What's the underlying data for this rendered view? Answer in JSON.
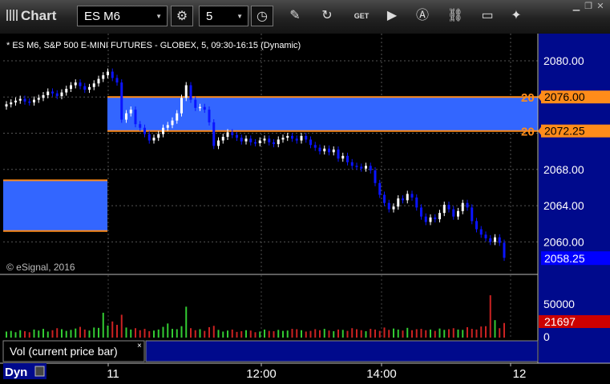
{
  "toolbar": {
    "app_title": "Chart",
    "symbol": "ES M6",
    "interval": "5",
    "icons": [
      "pencil-icon",
      "refresh-icon",
      "get-icon",
      "play-icon",
      "alert-icon",
      "link-icon",
      "comment-icon",
      "twitter-icon"
    ],
    "window_icons": [
      "minimize-icon",
      "restore-icon",
      "close-icon"
    ]
  },
  "chart_header": "* ES M6, S&P 500 E-MINI FUTURES - GLOBEX, 5, 09:30-16:15 (Dynamic)",
  "copyright": "© eSignal, 2016",
  "volume_label": "Vol (current price bar)",
  "dyn_label": "Dyn",
  "colors": {
    "background": "#000000",
    "up": "#ffffff",
    "down": "#0a14ff",
    "zone_fill": "#3366ff",
    "zone_edge": "#ff8c1a",
    "last_price_tag": "#0000ff",
    "volume_tag": "#cc0000",
    "axis_text": "#ffffff"
  },
  "chart_data": [
    {
      "type": "candlestick",
      "title": "",
      "ylim": [
        2056.5,
        2083.0
      ],
      "y_ticks": [
        "2080.00",
        "2076.00",
        "2072.00",
        "2068.00",
        "2064.00",
        "2060.00"
      ],
      "x_ticks": [
        "11",
        "12:00",
        "14:00",
        "12"
      ],
      "zones": [
        {
          "low": 2072.25,
          "high": 2076.0,
          "tag_low": "2072.25",
          "tag_high": "2076.00",
          "left_label": "20"
        },
        {
          "low": 2061.2,
          "high": 2066.8
        }
      ],
      "last_price": "2058.25",
      "close": [
        2075.2,
        2075.4,
        2075.6,
        2075.8,
        2075.5,
        2075.4,
        2075.7,
        2075.9,
        2076.2,
        2076.6,
        2076.4,
        2076.1,
        2076.5,
        2076.9,
        2077.3,
        2077.6,
        2077.2,
        2076.8,
        2077.1,
        2077.5,
        2078.0,
        2078.4,
        2078.8,
        2078.1,
        2077.6,
        2073.5,
        2074.2,
        2074.6,
        2073.0,
        2072.6,
        2071.9,
        2071.2,
        2071.5,
        2071.9,
        2072.6,
        2072.9,
        2073.4,
        2074.2,
        2075.9,
        2077.3,
        2075.7,
        2074.8,
        2074.9,
        2074.6,
        2073.2,
        2070.6,
        2071.2,
        2071.6,
        2072.1,
        2071.8,
        2071.5,
        2071.1,
        2071.4,
        2071.0,
        2070.9,
        2071.2,
        2071.4,
        2071.0,
        2070.8,
        2071.3,
        2071.5,
        2071.7,
        2071.4,
        2071.2,
        2071.7,
        2071.3,
        2070.7,
        2070.4,
        2070.0,
        2070.3,
        2069.9,
        2070.2,
        2069.2,
        2069.5,
        2068.8,
        2068.4,
        2068.3,
        2068.1,
        2068.4,
        2067.9,
        2066.5,
        2065.2,
        2064.3,
        2063.6,
        2063.9,
        2064.8,
        2064.6,
        2065.3,
        2064.9,
        2063.8,
        2062.8,
        2062.2,
        2062.7,
        2062.5,
        2063.2,
        2064.1,
        2063.6,
        2062.8,
        2063.4,
        2064.3,
        2063.8,
        2062.3,
        2061.4,
        2060.8,
        2060.4,
        2060.0,
        2060.5,
        2059.9,
        2058.25
      ],
      "volume": [
        9000,
        10000,
        8000,
        11000,
        9500,
        8000,
        12000,
        10500,
        13000,
        9000,
        11000,
        14000,
        12500,
        10000,
        11500,
        13500,
        16000,
        12000,
        10500,
        15000,
        14500,
        37000,
        18000,
        24000,
        19000,
        34000,
        15000,
        12000,
        14000,
        11000,
        13000,
        9500,
        10500,
        12000,
        16000,
        21000,
        13000,
        12500,
        17000,
        46000,
        14000,
        11000,
        12500,
        10000,
        15500,
        17500,
        11500,
        9000,
        10500,
        12000,
        8500,
        9500,
        11000,
        10500,
        8000,
        9000,
        12000,
        10000,
        9500,
        11500,
        10000,
        10500,
        13000,
        12500,
        11000,
        9000,
        10000,
        12500,
        11000,
        13000,
        10500,
        9500,
        12000,
        11500,
        10000,
        14000,
        12500,
        11000,
        9500,
        13000,
        12000,
        10000,
        15000,
        11500,
        13500,
        12000,
        10500,
        14500,
        11000,
        12500,
        13000,
        11000,
        12000,
        10000,
        13500,
        11500,
        12500,
        14000,
        12000,
        11500,
        15500,
        13000,
        12000,
        16500,
        17000,
        63000,
        26000,
        14000,
        21697
      ],
      "volume_axis": [
        "50000",
        "0"
      ],
      "volume_last": "21697"
    }
  ]
}
